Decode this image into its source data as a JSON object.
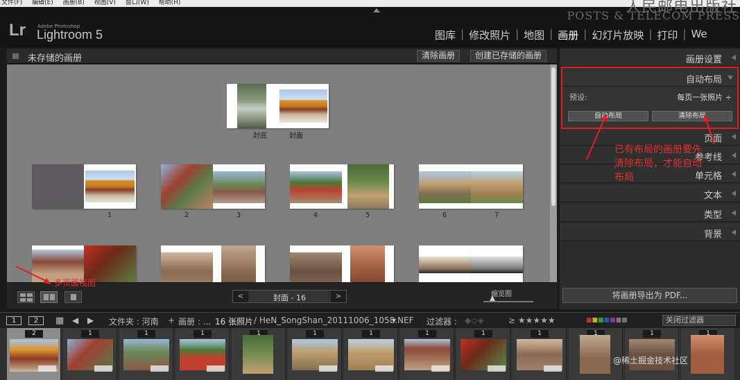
{
  "menubar": {
    "items": [
      "文件(F)",
      "编辑(E)",
      "画册(B)",
      "视图(V)",
      "窗口(W)",
      "帮助(H)"
    ]
  },
  "watermark": {
    "line1": "人民邮电出版社",
    "line2": "POSTS & TELECOM PRESS"
  },
  "app": {
    "logo": "Lr",
    "brand_small": "Adobe Photoshop",
    "brand": "Lightroom 5"
  },
  "modules": [
    "图库",
    "修改照片",
    "地图",
    "画册",
    "幻灯片放映",
    "打印",
    "We"
  ],
  "active_module": "画册",
  "center": {
    "title": "未存储的画册",
    "clear_button": "清除画册",
    "create_saved_button": "创建已存储的画册",
    "cover_labels": [
      "封底",
      "封面"
    ],
    "page_numbers": [
      "1",
      "2",
      "3",
      "4",
      "5",
      "6",
      "7"
    ]
  },
  "bottom": {
    "page_nav": "封面 - 16",
    "zoom_label": "缩览图",
    "annotation": "多页面视图"
  },
  "right_panel": {
    "sections": [
      "画册设置",
      "自动布局",
      "页面",
      "参考线",
      "单元格",
      "文本",
      "类型",
      "背景"
    ],
    "preset_label": "预设:",
    "preset_value": "每页一张照片 ÷",
    "auto_button": "自动布局",
    "clear_button": "清除布局",
    "note": "已有布局的画册要先\n清除布局，才能自动\n布局",
    "export_button": "将画册导出为 PDF..."
  },
  "filmbar": {
    "box1": "1",
    "box2": "2",
    "folder": "文件夹 : 河南",
    "album": "画册 : ...",
    "count": "16 张照片",
    "file": "/ HeN_SongShan_20111006_1058.NEF",
    "filter_label": "过滤器 :",
    "filter_value": "关闭过滤器"
  },
  "filmstrip": {
    "counts": [
      "2",
      "1",
      "1",
      "1",
      "1",
      "1",
      "1",
      "1",
      "1",
      "1",
      "1",
      "1",
      "1"
    ]
  },
  "corner_watermark": "@稀土掘金技术社区",
  "colors": {
    "accent_red": "#e02020",
    "panel_bg": "#2c2c2c",
    "canvas_bg": "#7f7f7f"
  }
}
